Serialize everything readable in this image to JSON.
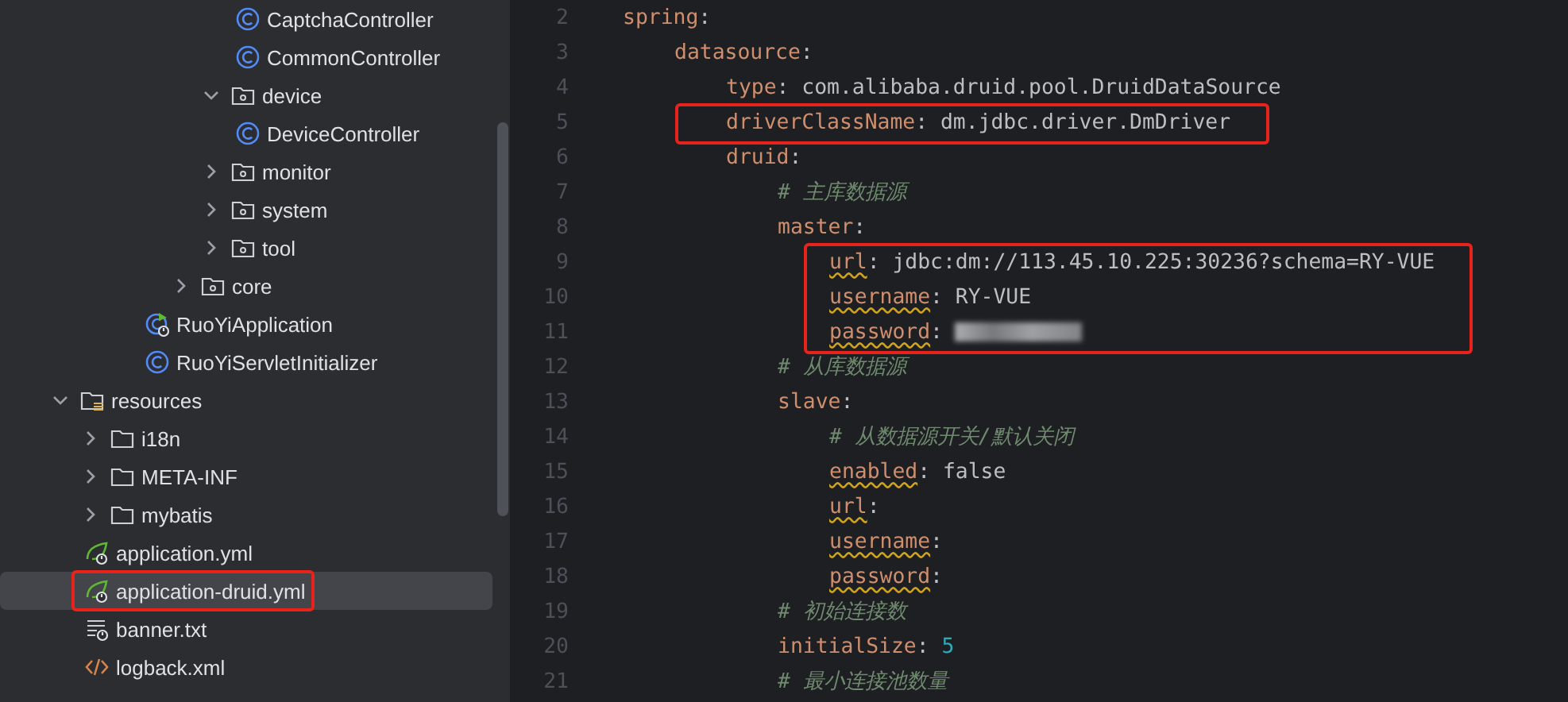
{
  "project_tree": {
    "items": [
      {
        "children": [
          {
            "children": [
              {
                "children": [
                  {
                    "children": [
                      {
                        "children": [
                          {
                            "children": [
                              {
                                "label": "CaptchaController",
                                "kind": "class",
                                "selected": false,
                                "boxed": false
                              },
                              {
                                "label": "CommonController",
                                "kind": "class",
                                "selected": false,
                                "boxed": false
                              }
                            ]
                          },
                          {
                            "label": "device",
                            "kind": "package",
                            "expanded": true,
                            "selected": false,
                            "boxed": false,
                            "children": [
                              {
                                "label": "DeviceController",
                                "kind": "class",
                                "selected": false,
                                "boxed": false
                              }
                            ]
                          },
                          {
                            "label": "monitor",
                            "kind": "package",
                            "expanded": false,
                            "selected": false,
                            "boxed": false
                          },
                          {
                            "label": "system",
                            "kind": "package",
                            "expanded": false,
                            "selected": false,
                            "boxed": false
                          },
                          {
                            "label": "tool",
                            "kind": "package",
                            "expanded": false,
                            "selected": false,
                            "boxed": false
                          }
                        ]
                      },
                      {
                        "label": "core",
                        "kind": "package",
                        "expanded": false,
                        "selected": false,
                        "boxed": false
                      }
                    ]
                  },
                  {
                    "label": "RuoYiApplication",
                    "kind": "spring-class",
                    "selected": false,
                    "boxed": false
                  },
                  {
                    "label": "RuoYiServletInitializer",
                    "kind": "class",
                    "selected": false,
                    "boxed": false
                  }
                ]
              }
            ]
          }
        ]
      },
      {
        "label": "resources",
        "kind": "resources-folder",
        "expanded": true,
        "selected": false,
        "boxed": false,
        "children": [
          {
            "label": "i18n",
            "kind": "folder",
            "expanded": false,
            "selected": false,
            "boxed": false
          },
          {
            "label": "META-INF",
            "kind": "folder",
            "expanded": false,
            "selected": false,
            "boxed": false
          },
          {
            "label": "mybatis",
            "kind": "folder",
            "expanded": false,
            "selected": false,
            "boxed": false
          },
          {
            "label": "application.yml",
            "kind": "spring-yaml",
            "selected": false,
            "boxed": false
          },
          {
            "label": "application-druid.yml",
            "kind": "spring-yaml",
            "selected": true,
            "boxed": true
          },
          {
            "label": "banner.txt",
            "kind": "text-file",
            "selected": false,
            "boxed": false
          },
          {
            "label": "logback.xml",
            "kind": "xml-file",
            "selected": false,
            "boxed": false
          }
        ]
      }
    ]
  },
  "editor": {
    "lines": [
      {
        "n": "2",
        "boxed": false,
        "parts": [
          {
            "t": "spring",
            "kind": "key",
            "typo": false
          },
          {
            "t": ":",
            "kind": "punct"
          }
        ],
        "children": [
          {
            "n": "3",
            "boxed": false,
            "parts": [
              {
                "t": "datasource",
                "kind": "key",
                "typo": false
              },
              {
                "t": ":",
                "kind": "punct"
              }
            ],
            "children": [
              {
                "n": "4",
                "boxed": false,
                "parts": [
                  {
                    "t": "type",
                    "kind": "key",
                    "typo": false
                  },
                  {
                    "t": ":",
                    "kind": "punct"
                  },
                  {
                    "t": "com.alibaba.druid.pool.DruidDataSource",
                    "kind": "value"
                  }
                ]
              },
              {
                "n": "5",
                "boxed": true,
                "parts": [
                  {
                    "t": "driverClassName",
                    "kind": "key",
                    "typo": false
                  },
                  {
                    "t": ":",
                    "kind": "punct"
                  },
                  {
                    "t": "dm.jdbc.driver.DmDriver",
                    "kind": "value"
                  }
                ]
              },
              {
                "n": "6",
                "boxed": false,
                "parts": [
                  {
                    "t": "druid",
                    "kind": "key",
                    "typo": false
                  },
                  {
                    "t": ":",
                    "kind": "punct"
                  }
                ],
                "children": [
                  {
                    "n": "7",
                    "boxed": false,
                    "parts": [
                      {
                        "t": "# 主库数据源",
                        "kind": "comment"
                      }
                    ]
                  },
                  {
                    "n": "8",
                    "boxed": false,
                    "parts": [
                      {
                        "t": "master",
                        "kind": "key",
                        "typo": false
                      },
                      {
                        "t": ":",
                        "kind": "punct"
                      }
                    ],
                    "children": [
                      {
                        "n": "9",
                        "boxed": true,
                        "parts": [
                          {
                            "t": "url",
                            "kind": "key",
                            "typo": true
                          },
                          {
                            "t": ":",
                            "kind": "punct"
                          },
                          {
                            "t": "jdbc:dm://113.45.10.225:30236?schema=RY-VUE",
                            "kind": "value"
                          }
                        ]
                      },
                      {
                        "n": "10",
                        "boxed": true,
                        "parts": [
                          {
                            "t": "username",
                            "kind": "key",
                            "typo": true
                          },
                          {
                            "t": ":",
                            "kind": "punct"
                          },
                          {
                            "t": "RY-VUE",
                            "kind": "value"
                          }
                        ]
                      },
                      {
                        "n": "11",
                        "boxed": true,
                        "parts": [
                          {
                            "t": "password",
                            "kind": "key",
                            "typo": true
                          },
                          {
                            "t": ":",
                            "kind": "punct"
                          },
                          {
                            "kind": "redacted"
                          }
                        ]
                      }
                    ]
                  },
                  {
                    "n": "12",
                    "boxed": false,
                    "parts": [
                      {
                        "t": "# 从库数据源",
                        "kind": "comment"
                      }
                    ]
                  },
                  {
                    "n": "13",
                    "boxed": false,
                    "parts": [
                      {
                        "t": "slave",
                        "kind": "key",
                        "typo": false
                      },
                      {
                        "t": ":",
                        "kind": "punct"
                      }
                    ],
                    "children": [
                      {
                        "n": "14",
                        "boxed": false,
                        "parts": [
                          {
                            "t": "# 从数据源开关/默认关闭",
                            "kind": "comment"
                          }
                        ]
                      },
                      {
                        "n": "15",
                        "boxed": false,
                        "parts": [
                          {
                            "t": "enabled",
                            "kind": "key",
                            "typo": true
                          },
                          {
                            "t": ":",
                            "kind": "punct"
                          },
                          {
                            "t": "false",
                            "kind": "value"
                          }
                        ]
                      },
                      {
                        "n": "16",
                        "boxed": false,
                        "parts": [
                          {
                            "t": "url",
                            "kind": "key",
                            "typo": true
                          },
                          {
                            "t": ":",
                            "kind": "punct"
                          }
                        ]
                      },
                      {
                        "n": "17",
                        "boxed": false,
                        "parts": [
                          {
                            "t": "username",
                            "kind": "key",
                            "typo": true
                          },
                          {
                            "t": ":",
                            "kind": "punct"
                          }
                        ]
                      },
                      {
                        "n": "18",
                        "boxed": false,
                        "parts": [
                          {
                            "t": "password",
                            "kind": "key",
                            "typo": true
                          },
                          {
                            "t": ":",
                            "kind": "punct"
                          }
                        ]
                      }
                    ]
                  },
                  {
                    "n": "19",
                    "boxed": false,
                    "parts": [
                      {
                        "t": "# 初始连接数",
                        "kind": "comment"
                      }
                    ]
                  },
                  {
                    "n": "20",
                    "boxed": false,
                    "parts": [
                      {
                        "t": "initialSize",
                        "kind": "key",
                        "typo": false
                      },
                      {
                        "t": ":",
                        "kind": "punct"
                      },
                      {
                        "t": "5",
                        "kind": "number"
                      }
                    ]
                  },
                  {
                    "n": "21",
                    "boxed": false,
                    "parts": [
                      {
                        "t": "# 最小连接池数量",
                        "kind": "comment"
                      }
                    ]
                  }
                ]
              }
            ]
          }
        ]
      }
    ]
  }
}
